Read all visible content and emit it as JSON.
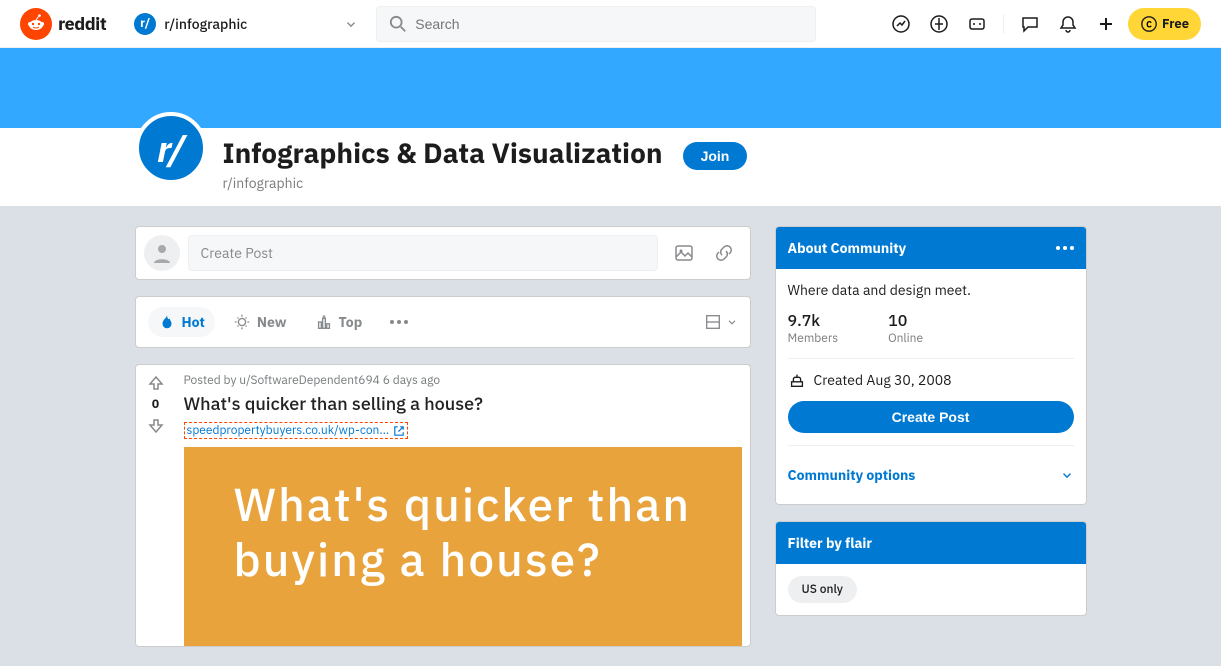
{
  "header": {
    "logo_text": "reddit",
    "nav_subreddit": "r/infographic",
    "search_placeholder": "Search",
    "free_label": "Free"
  },
  "community": {
    "icon_text": "r/",
    "title": "Infographics & Data Visualization",
    "subreddit": "r/infographic",
    "join_label": "Join"
  },
  "create_post": {
    "placeholder": "Create Post"
  },
  "sort": {
    "hot": "Hot",
    "new": "New",
    "top": "Top"
  },
  "post": {
    "score": "0",
    "meta_prefix": "Posted by ",
    "author": "u/SoftwareDependent694",
    "time": "6 days ago",
    "title": "What's quicker than selling a house?",
    "link_text": "speedpropertybuyers.co.uk/wp-con...",
    "image_text": "What's quicker than buying a house?"
  },
  "sidebar": {
    "about_title": "About Community",
    "description": "Where data and design meet.",
    "members_num": "9.7k",
    "members_lbl": "Members",
    "online_num": "10",
    "online_lbl": "Online",
    "created_text": "Created Aug 30, 2008",
    "create_btn": "Create Post",
    "options_label": "Community options",
    "filter_title": "Filter by flair",
    "flair1": "US only"
  }
}
